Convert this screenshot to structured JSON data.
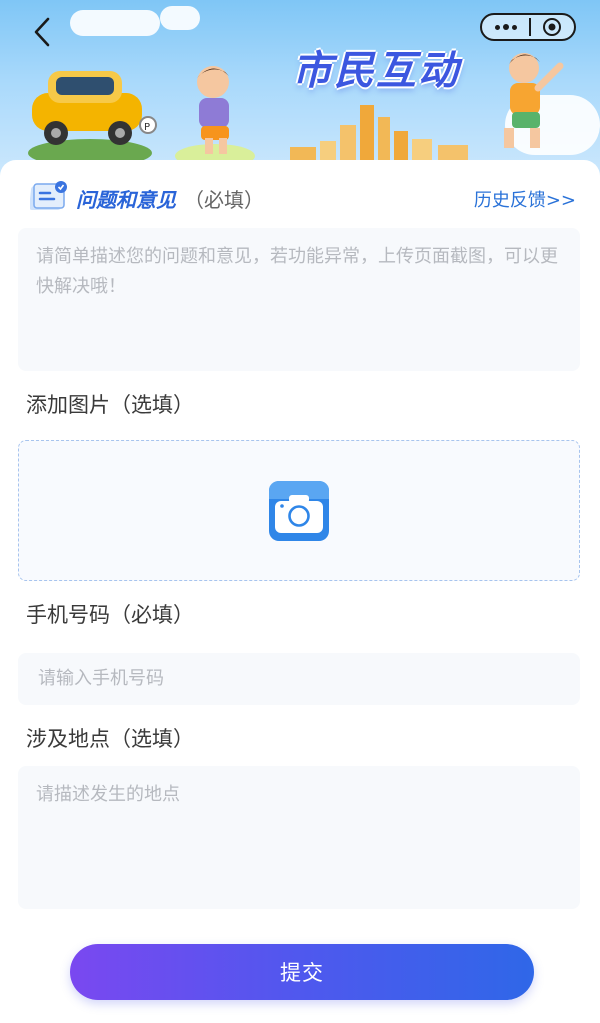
{
  "banner": {
    "title": "市民互动"
  },
  "feedback": {
    "title": "问题和意见",
    "required_tag": "（必填）",
    "history_link": "历史反馈>>",
    "placeholder": "请简单描述您的问题和意见，若功能异常，上传页面截图，可以更快解决哦！"
  },
  "image": {
    "label": "添加图片（选填）"
  },
  "phone": {
    "label": "手机号码（必填）",
    "placeholder": "请输入手机号码"
  },
  "location": {
    "label": "涉及地点（选填）",
    "placeholder": "请描述发生的地点"
  },
  "submit": {
    "label": "提交"
  },
  "icons": {
    "back": "chevron-left-icon",
    "more": "more-dots-icon",
    "close": "target-close-icon",
    "feedback": "feedback-card-icon",
    "camera": "camera-icon"
  },
  "colors": {
    "accent_blue": "#2a72d8",
    "submit_start": "#7a48f0",
    "submit_end": "#2f67e8",
    "banner_sky": "#7fc6f6"
  }
}
